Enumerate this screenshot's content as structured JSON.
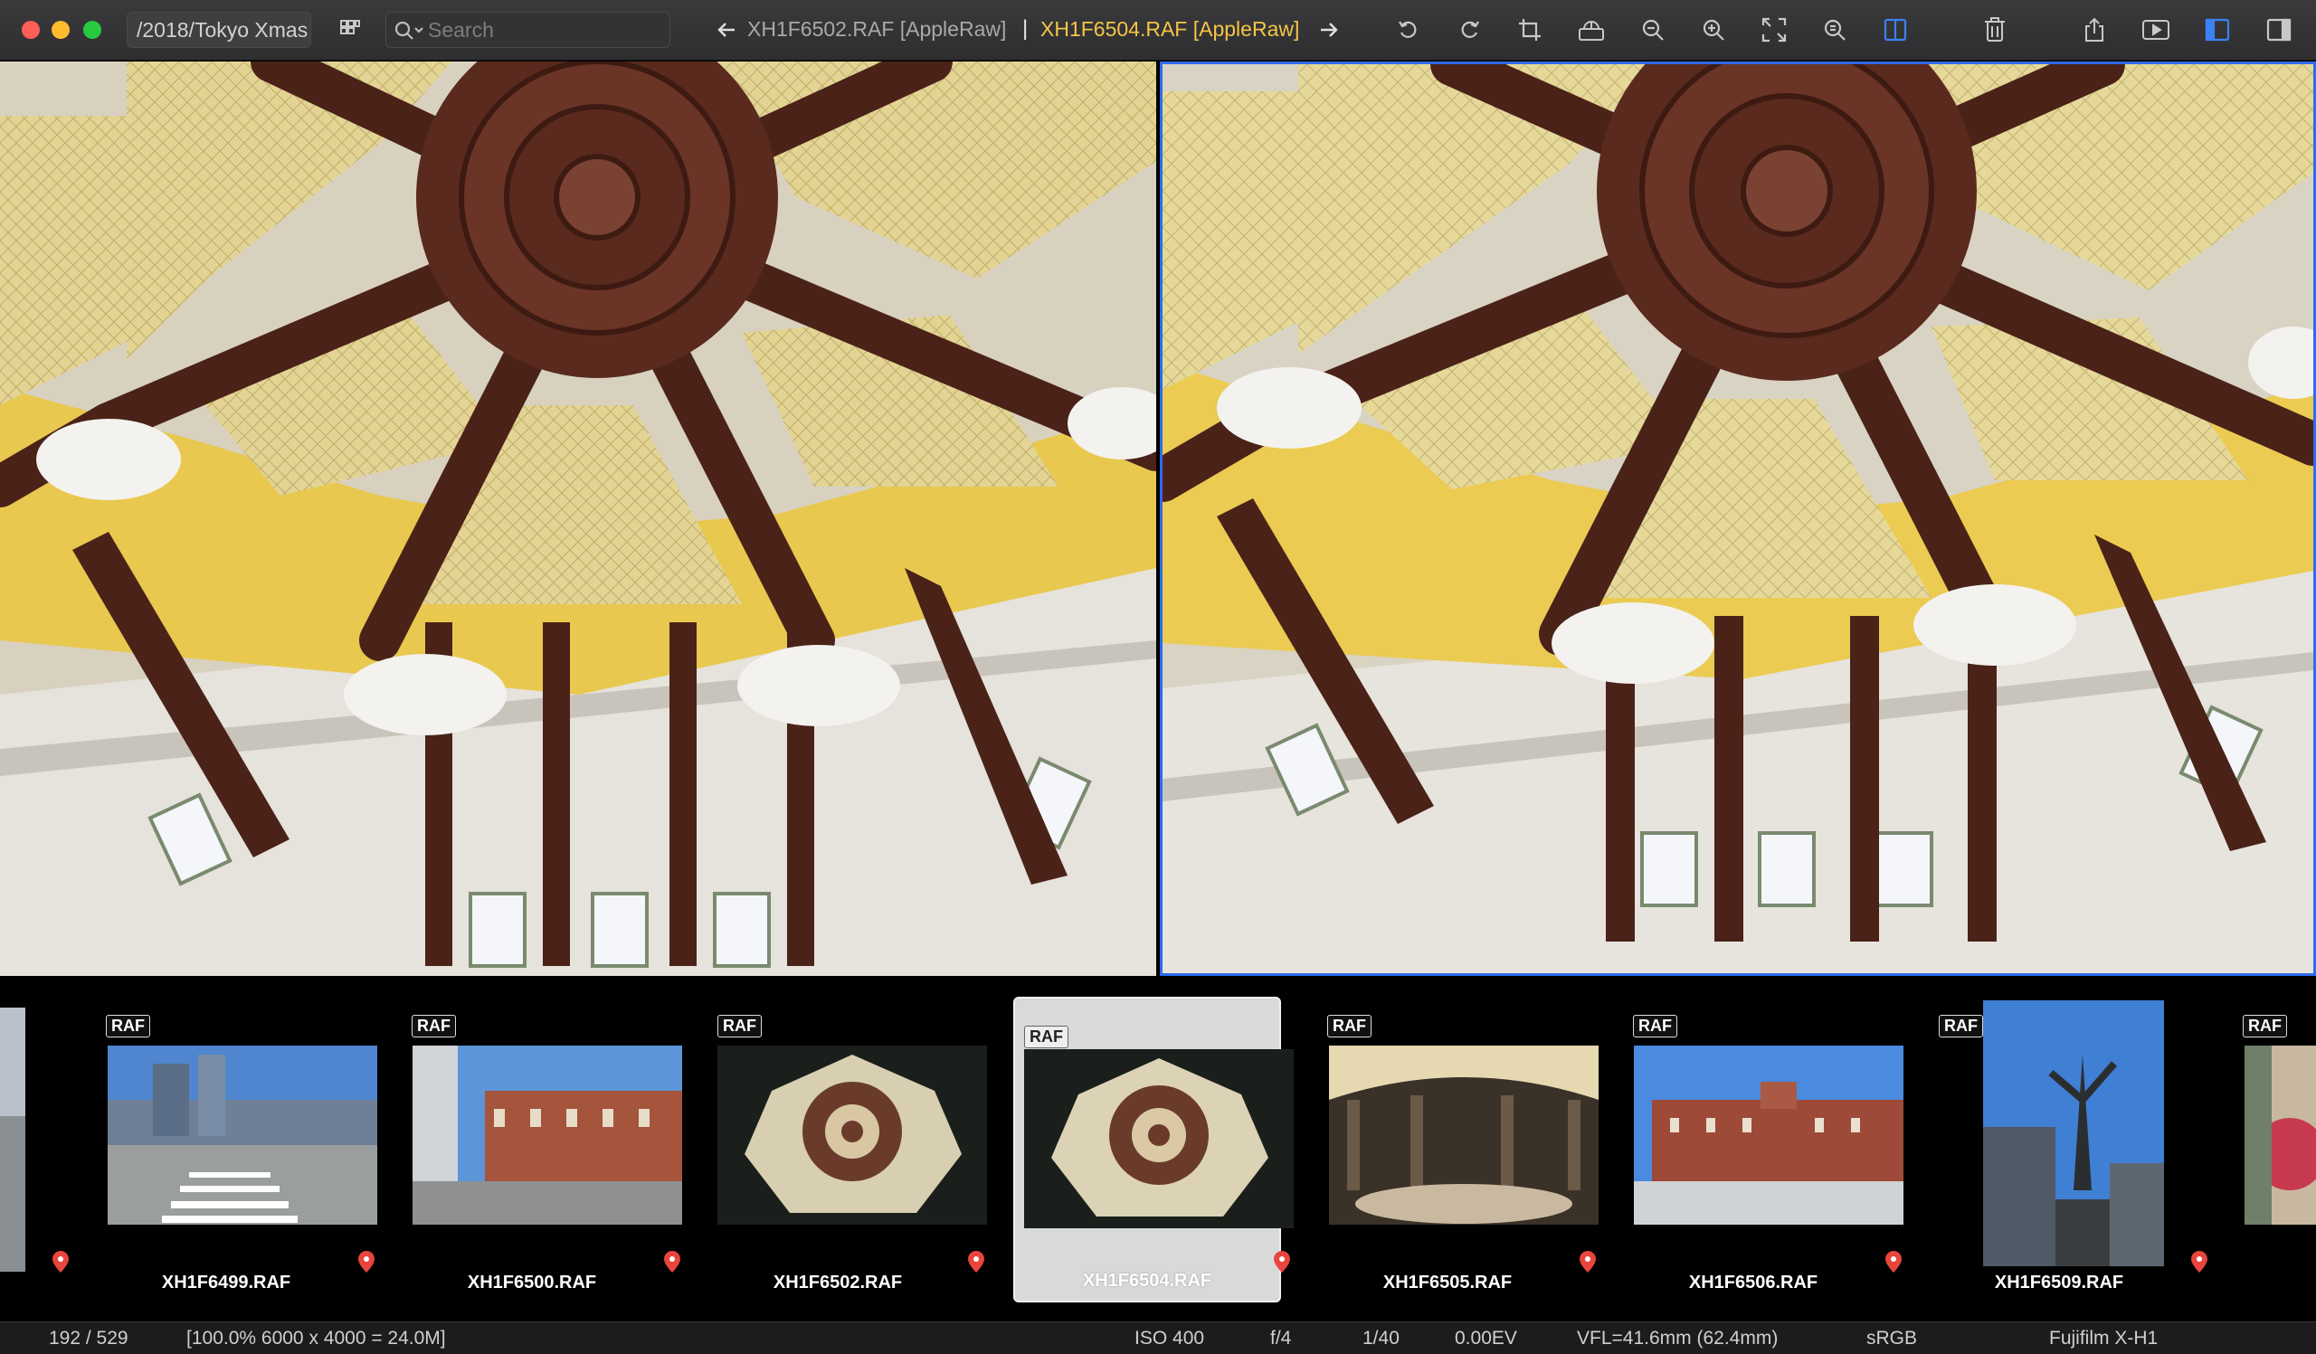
{
  "window": {
    "folder_path": "/2018/Tokyo Xmas"
  },
  "search": {
    "placeholder": "Search",
    "value": ""
  },
  "navigation": {
    "previous_file": "XH1F6502.RAF [AppleRaw]",
    "separator": "|",
    "current_file": "XH1F6504.RAF [AppleRaw]"
  },
  "toolbar_icons": [
    "rotate-left-icon",
    "rotate-right-icon",
    "crop-icon",
    "adjust-icon",
    "zoom-out-icon",
    "zoom-in-icon",
    "fit-screen-icon",
    "actual-size-icon",
    "compare-icon",
    "trash-icon",
    "share-icon",
    "slideshow-icon",
    "left-panel-icon",
    "right-panel-icon"
  ],
  "colors": {
    "current_file": "#f6c547",
    "selection_border": "#2d6bf0",
    "pin": "#e8453c"
  },
  "filmstrip": {
    "badge": "RAF",
    "items": [
      {
        "name": "",
        "selected": false
      },
      {
        "name": "XH1F6499.RAF",
        "selected": false
      },
      {
        "name": "XH1F6500.RAF",
        "selected": false
      },
      {
        "name": "XH1F6502.RAF",
        "selected": false
      },
      {
        "name": "XH1F6504.RAF",
        "selected": true
      },
      {
        "name": "XH1F6505.RAF",
        "selected": false
      },
      {
        "name": "XH1F6506.RAF",
        "selected": false
      },
      {
        "name": "XH1F6509.RAF",
        "selected": false
      },
      {
        "name": "",
        "selected": false
      }
    ]
  },
  "status": {
    "index": "192 / 529",
    "zoom_info": "[100.0% 6000 x 4000 = 24.0M]",
    "iso": "ISO 400",
    "aperture": "f/4",
    "shutter": "1/40",
    "exposure": "0.00EV",
    "focal_length": "VFL=41.6mm (62.4mm)",
    "color_space": "sRGB",
    "camera": "Fujifilm X-H1"
  }
}
